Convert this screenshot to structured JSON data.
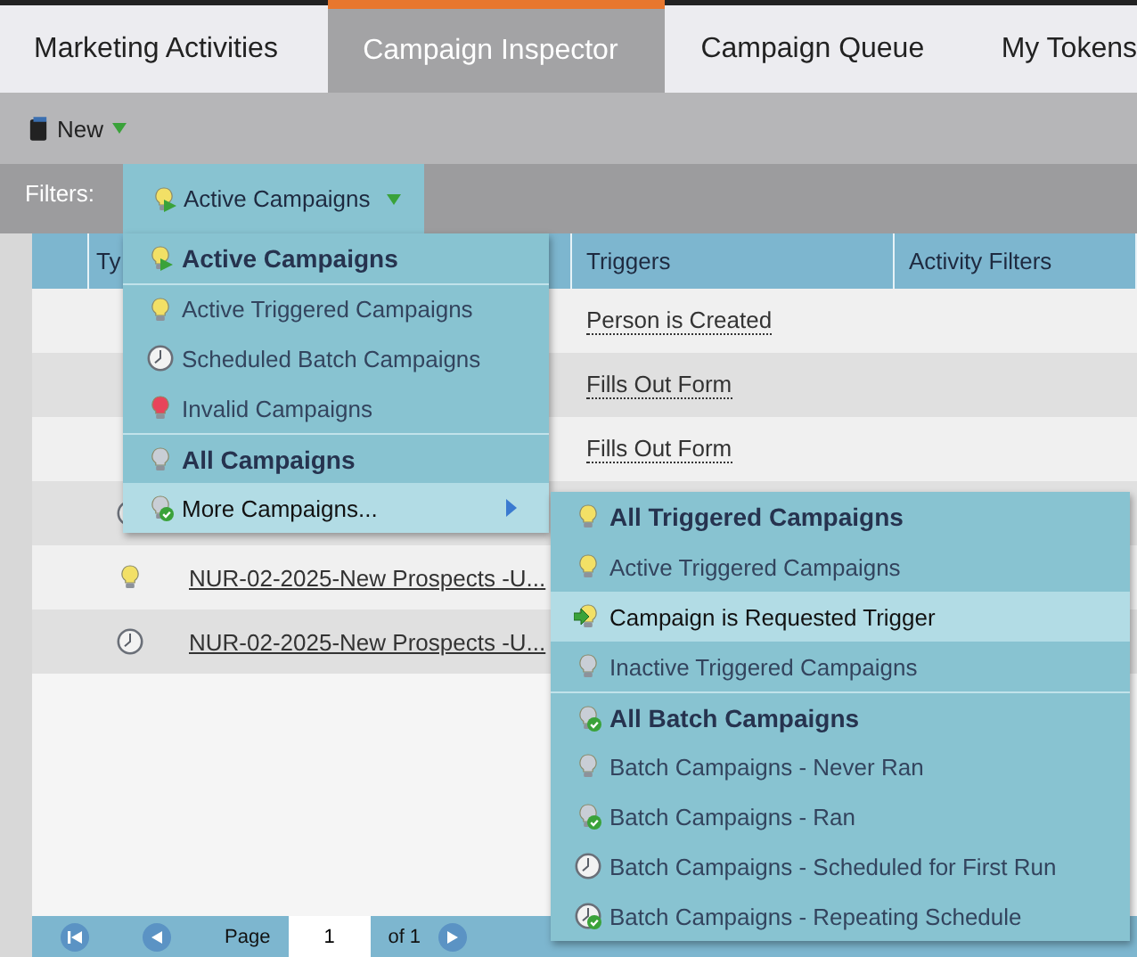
{
  "tabs": [
    {
      "label": "Marketing Activities",
      "selected": false
    },
    {
      "label": "Campaign Inspector",
      "selected": true
    },
    {
      "label": "Campaign Queue",
      "selected": false
    },
    {
      "label": "My Tokens",
      "selected": false
    }
  ],
  "toolbar": {
    "new_button": "New"
  },
  "filters": {
    "label": "Filters:",
    "dropdown": {
      "kind": "bulb_play",
      "label": "Active Campaigns"
    }
  },
  "table": {
    "columns": [
      "Ty",
      "Triggers",
      "Activity Filters"
    ],
    "rows": [
      {
        "trigger": "Person is Created"
      },
      {
        "trigger": "Fills Out Form"
      },
      {
        "trigger": "Fills Out Form"
      },
      {
        "kind": "clock"
      },
      {
        "kind": "bulb",
        "name": "NUR-02-2025-New Prospects -U..."
      },
      {
        "kind": "clock",
        "name": "NUR-02-2025-New Prospects -U..."
      }
    ]
  },
  "menu": {
    "items": [
      {
        "kind": "bulb_play",
        "bold": true,
        "label": "Active Campaigns",
        "divider": false,
        "submenu": false,
        "selected": false
      },
      {
        "kind": "bulb",
        "bold": false,
        "label": "Active Triggered Campaigns",
        "divider": true,
        "submenu": false,
        "selected": false
      },
      {
        "kind": "clock",
        "bold": false,
        "label": "Scheduled Batch Campaigns",
        "divider": false,
        "submenu": false,
        "selected": false
      },
      {
        "kind": "bulb_red",
        "bold": false,
        "label": "Invalid Campaigns",
        "divider": false,
        "submenu": false,
        "selected": false
      },
      {
        "kind": "bulb_gray",
        "bold": true,
        "label": "All Campaigns",
        "divider": true,
        "submenu": false,
        "selected": false
      },
      {
        "kind": "bulb_gray_check",
        "bold": false,
        "label": "More Campaigns...",
        "divider": false,
        "submenu": true,
        "selected": true
      }
    ]
  },
  "submenu": {
    "items": [
      {
        "kind": "bulb",
        "bold": true,
        "label": "All Triggered Campaigns",
        "divider": false,
        "selected": false
      },
      {
        "kind": "bulb",
        "bold": false,
        "label": "Active Triggered Campaigns",
        "divider": false,
        "selected": false
      },
      {
        "kind": "bulb_arrow",
        "bold": false,
        "label": "Campaign is Requested Trigger",
        "divider": false,
        "selected": true
      },
      {
        "kind": "bulb_gray",
        "bold": false,
        "label": "Inactive Triggered Campaigns",
        "divider": false,
        "selected": false
      },
      {
        "kind": "bulb_gray_check",
        "bold": true,
        "label": "All Batch Campaigns",
        "divider": true,
        "selected": false
      },
      {
        "kind": "bulb_gray",
        "bold": false,
        "label": "Batch Campaigns - Never Ran",
        "divider": false,
        "selected": false
      },
      {
        "kind": "bulb_gray_check",
        "bold": false,
        "label": "Batch Campaigns - Ran",
        "divider": false,
        "selected": false
      },
      {
        "kind": "clock",
        "bold": false,
        "label": "Batch Campaigns - Scheduled for First Run",
        "divider": false,
        "selected": false
      },
      {
        "kind": "clock_check",
        "bold": false,
        "label": "Batch Campaigns - Repeating Schedule",
        "divider": false,
        "selected": false
      }
    ]
  },
  "pager": {
    "label": "Page",
    "page": "1",
    "total": "of 1"
  }
}
